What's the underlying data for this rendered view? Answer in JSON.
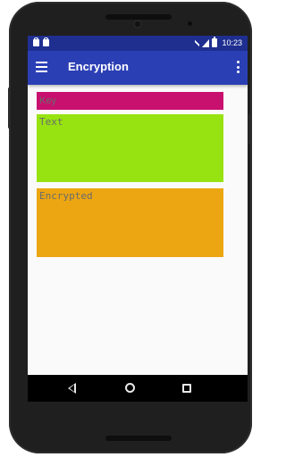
{
  "status_bar": {
    "time": "10:23",
    "icons": [
      "notification-icon",
      "notification-icon",
      "no-network-icon",
      "signal-icon",
      "battery-icon"
    ]
  },
  "toolbar": {
    "title": "Encryption",
    "menu_icon": "hamburger-menu-icon",
    "overflow_icon": "overflow-menu-icon"
  },
  "form": {
    "key": {
      "value": "",
      "placeholder": "Key"
    },
    "text": {
      "value": "",
      "placeholder": "Text"
    },
    "encrypted": {
      "value": "",
      "placeholder": "Encrypted"
    }
  },
  "colors": {
    "status_bar": "#1e2f90",
    "toolbar": "#2b3fb5",
    "key_field": "#c8106f",
    "text_field": "#97e312",
    "encrypted_field": "#eca612",
    "hint_text": "#6b6b6b"
  },
  "nav_bar": {
    "icons": [
      "back-icon",
      "home-icon",
      "recents-icon"
    ]
  }
}
